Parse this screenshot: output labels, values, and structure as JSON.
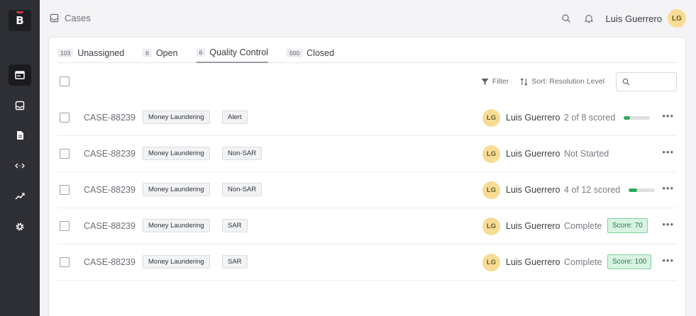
{
  "header": {
    "breadcrumb": "Cases",
    "user_name": "Luis Guerrero",
    "user_initials": "LG"
  },
  "sidebar": {
    "logo_letter": "B",
    "items": [
      {
        "icon": "cases-icon",
        "active": true
      },
      {
        "icon": "inbox-icon",
        "active": false
      },
      {
        "icon": "document-icon",
        "active": false
      },
      {
        "icon": "code-icon",
        "active": false
      },
      {
        "icon": "analytics-icon",
        "active": false
      },
      {
        "icon": "settings-icon",
        "active": false
      }
    ]
  },
  "tabs": [
    {
      "count": "103",
      "label": "Unassigned",
      "active": false
    },
    {
      "count": "6",
      "label": "Open",
      "active": false
    },
    {
      "count": "6",
      "label": "Quality Control",
      "active": true
    },
    {
      "count": "500",
      "label": "Closed",
      "active": false
    }
  ],
  "toolbar": {
    "filter_label": "Filter",
    "sort_label": "Sort: Resolution Level"
  },
  "rows": [
    {
      "id": "CASE-88239",
      "tag1": "Money Laundering",
      "tag2": "Alert",
      "initials": "LG",
      "assignee": "Luis Guerrero",
      "status": "2 of 8 scored",
      "progress": 0.25,
      "score": ""
    },
    {
      "id": "CASE-88239",
      "tag1": "Money Laundering",
      "tag2": "Non-SAR",
      "initials": "LG",
      "assignee": "Luis Guerrero",
      "status": "Not Started",
      "progress": null,
      "score": ""
    },
    {
      "id": "CASE-88239",
      "tag1": "Money Laundering",
      "tag2": "Non-SAR",
      "initials": "LG",
      "assignee": "Luis Guerrero",
      "status": "4 of 12 scored",
      "progress": 0.33,
      "score": ""
    },
    {
      "id": "CASE-88239",
      "tag1": "Money Laundering",
      "tag2": "SAR",
      "initials": "LG",
      "assignee": "Luis Guerrero",
      "status": "Complete",
      "progress": null,
      "score": "Score: 70"
    },
    {
      "id": "CASE-88239",
      "tag1": "Money Laundering",
      "tag2": "SAR",
      "initials": "LG",
      "assignee": "Luis Guerrero",
      "status": "Complete",
      "progress": null,
      "score": "Score: 100"
    }
  ],
  "more_glyph": "•••"
}
